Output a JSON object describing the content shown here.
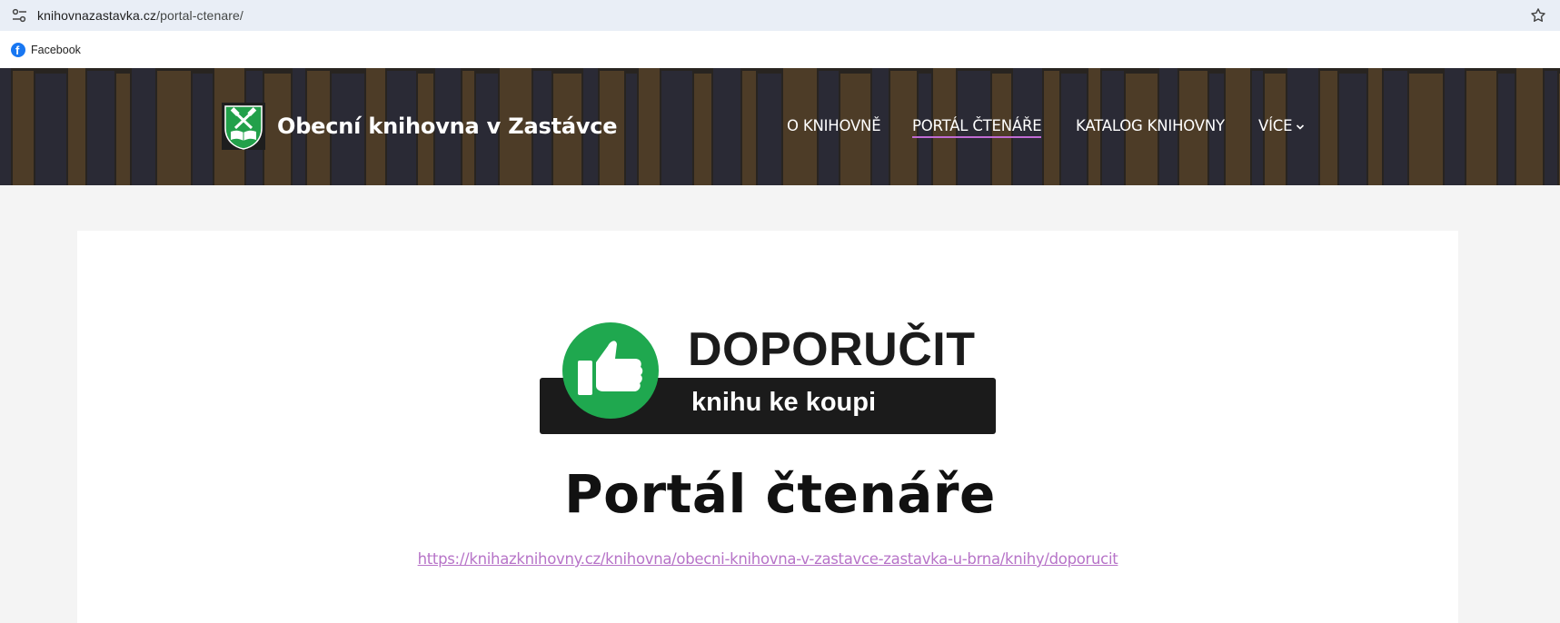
{
  "browser": {
    "url_host": "knihovnazastavka.cz",
    "url_path": "/portal-ctenare/",
    "bookmarks": [
      {
        "label": "Facebook",
        "icon": "facebook-icon"
      }
    ]
  },
  "site": {
    "title": "Obecní knihovna v Zastávce",
    "logo": "library-crest-icon"
  },
  "nav": {
    "items": [
      {
        "label": "O KNIHOVNĚ",
        "active": false
      },
      {
        "label": "PORTÁL ČTENÁŘE",
        "active": true
      },
      {
        "label": "KATALOG KNIHOVNY",
        "active": false
      },
      {
        "label": "VÍCE",
        "active": false,
        "has_dropdown": true
      }
    ],
    "active_color": "#c06bd3"
  },
  "banner": {
    "headline": "DOPORUČIT",
    "subline": "knihu ke koupi",
    "icon": "thumbs-up-icon",
    "accent": "#1fa84f"
  },
  "main": {
    "title": "Portál čtenáře",
    "link": "https://knihazknihovny.cz/knihovna/obecni-knihovna-v-zastavce-zastavka-u-brna/knihy/doporucit",
    "link_color": "#b774c8"
  }
}
